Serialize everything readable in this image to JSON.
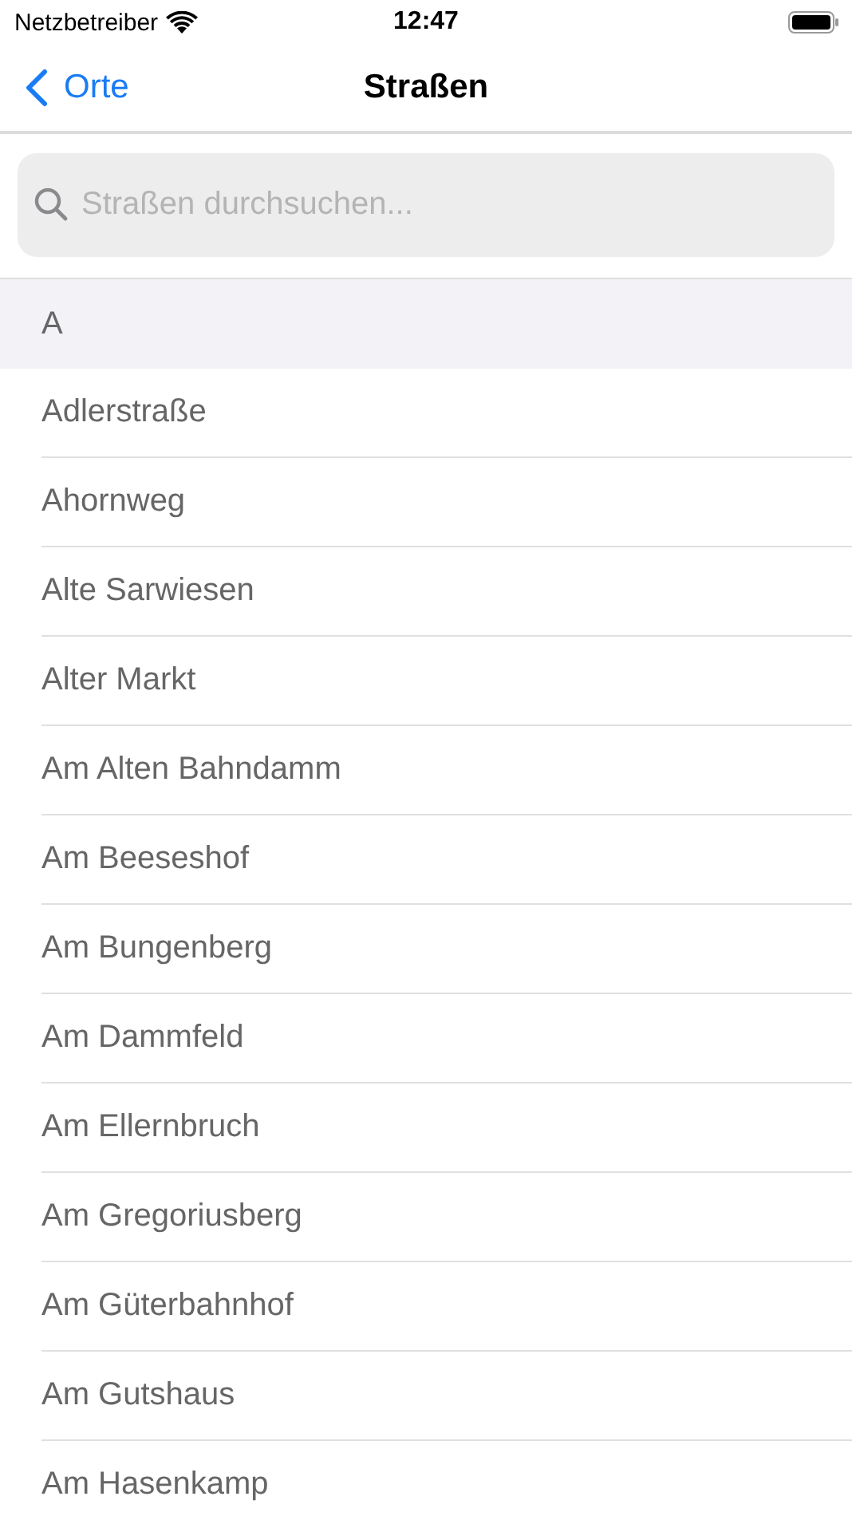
{
  "status_bar": {
    "carrier": "Netzbetreiber",
    "time": "12:47"
  },
  "nav": {
    "back": "Orte",
    "title": "Straßen"
  },
  "search": {
    "placeholder": "Straßen durchsuchen..."
  },
  "sections": [
    {
      "header": "A",
      "rows": [
        {
          "label": "Adlerstraße"
        },
        {
          "label": "Ahornweg"
        },
        {
          "label": "Alte Sarwiesen"
        },
        {
          "label": "Alter Markt"
        },
        {
          "label": "Am Alten Bahndamm"
        },
        {
          "label": "Am Beeseshof"
        },
        {
          "label": "Am Bungenberg"
        },
        {
          "label": "Am Dammfeld"
        },
        {
          "label": "Am Ellernbruch"
        },
        {
          "label": "Am Gregoriusberg"
        },
        {
          "label": "Am Güterbahnhof"
        },
        {
          "label": "Am Gutshaus"
        },
        {
          "label": "Am Hasenkamp"
        }
      ]
    }
  ]
}
